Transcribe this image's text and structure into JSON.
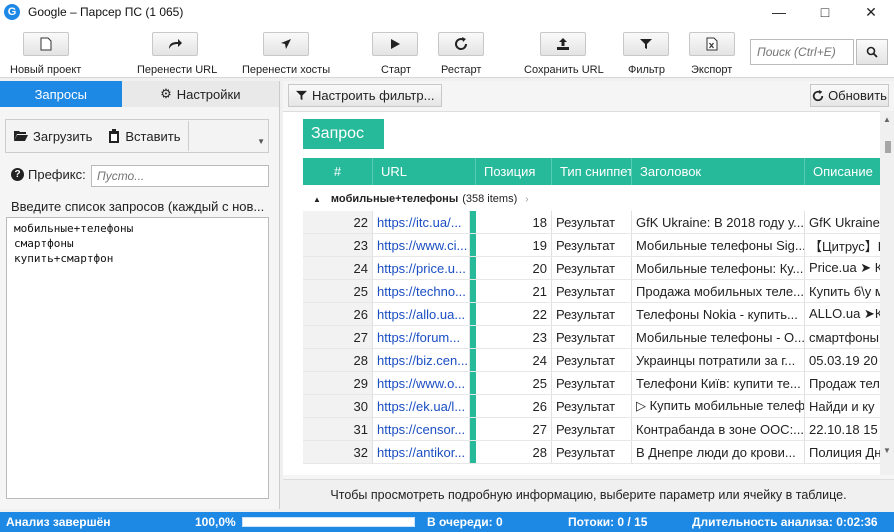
{
  "window": {
    "title": "Google – Парсер ПС (1 065)",
    "app_icon": "G"
  },
  "toolbar": {
    "new_project": "Новый проект",
    "move_url": "Перенести URL",
    "move_hosts": "Перенести хосты",
    "start": "Старт",
    "restart": "Рестарт",
    "save_url": "Сохранить URL",
    "filter": "Фильтр",
    "export": "Экспорт",
    "search_placeholder": "Поиск (Ctrl+E)"
  },
  "left": {
    "tab_queries": "Запросы",
    "tab_settings": "Настройки",
    "load": "Загрузить",
    "paste": "Вставить",
    "prefix_label": "Префикс:",
    "prefix_placeholder": "Пусто...",
    "queries_hint": "Введите список запросов (каждый с нов...",
    "queries": [
      "мобильные+телефоны",
      "смартфоны",
      "купить+смартфон"
    ]
  },
  "right": {
    "configure_filter": "Настроить фильтр...",
    "refresh": "Обновить",
    "group_tag": "Запрос",
    "columns": [
      "#",
      "URL",
      "Позиция",
      "Тип сниппета",
      "Заголовок",
      "Описание"
    ],
    "group": {
      "name": "мобильные+телефоны",
      "count": "(358 items)"
    },
    "rows": [
      {
        "num": "22",
        "url": "https://itc.ua/...",
        "pos": "18",
        "type": "Результат",
        "title": "GfK Ukraine: В 2018 году у...",
        "desc": "GfK Ukraine"
      },
      {
        "num": "23",
        "url": "https://www.ci...",
        "pos": "19",
        "type": "Результат",
        "title": "Мобильные телефоны Sig...",
        "desc": "【Цитрус】Ку"
      },
      {
        "num": "24",
        "url": "https://price.u...",
        "pos": "20",
        "type": "Результат",
        "title": "Мобильные телефоны: Ку...",
        "desc": "Price.ua ➤ Ку"
      },
      {
        "num": "25",
        "url": "https://techno...",
        "pos": "21",
        "type": "Результат",
        "title": "Продажа мобильных теле...",
        "desc": "Купить б\\у м"
      },
      {
        "num": "26",
        "url": "https://allo.ua...",
        "pos": "22",
        "type": "Результат",
        "title": "Телефоны Nokia - купить...",
        "desc": "ALLO.ua ➤К"
      },
      {
        "num": "27",
        "url": "https://forum...",
        "pos": "23",
        "type": "Результат",
        "title": "Мобильные телефоны - О...",
        "desc": "смартфоны"
      },
      {
        "num": "28",
        "url": "https://biz.cen...",
        "pos": "24",
        "type": "Результат",
        "title": "Украинцы потратили за г...",
        "desc": "05.03.19 20"
      },
      {
        "num": "29",
        "url": "https://www.o...",
        "pos": "25",
        "type": "Результат",
        "title": "Телефони Київ: купити те...",
        "desc": "Продаж теле"
      },
      {
        "num": "30",
        "url": "https://ek.ua/l...",
        "pos": "26",
        "type": "Результат",
        "title": "▷ Купить мобильные телеф...",
        "desc": "Найди и ку"
      },
      {
        "num": "31",
        "url": "https://censor...",
        "pos": "27",
        "type": "Результат",
        "title": "Контрабанда в зоне ООС:...",
        "desc": "22.10.18 15"
      },
      {
        "num": "32",
        "url": "https://antikor...",
        "pos": "28",
        "type": "Результат",
        "title": "В Днепре люди до крови...",
        "desc": "Полиция Дн"
      }
    ],
    "info": "Чтобы просмотреть подробную информацию, выберите параметр или ячейку в таблице."
  },
  "status": {
    "state": "Анализ завершён",
    "percent": "100,0%",
    "progress": 1.0,
    "queue": "В очереди: 0",
    "threads": "Потоки: 0 / 15",
    "duration": "Длительность анализа: 0:02:36"
  },
  "colors": {
    "accent": "#1e88e5",
    "grid": "#26b99a",
    "link": "#1a4ec2"
  }
}
